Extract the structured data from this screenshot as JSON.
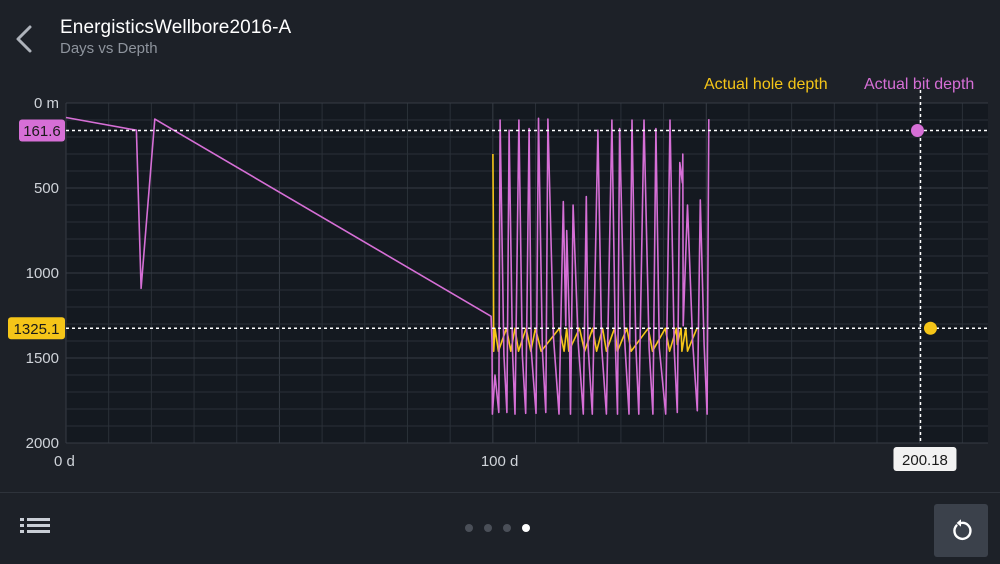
{
  "header": {
    "title": "EnergisticsWellbore2016-A",
    "subtitle": "Days vs Depth",
    "back_icon": "chevron-left-icon"
  },
  "legend": {
    "hole": {
      "label": "Actual hole depth",
      "color": "#f5c518"
    },
    "bit": {
      "label": "Actual bit depth",
      "color": "#d66fd6"
    }
  },
  "chart_data": {
    "type": "line",
    "xlim": [
      0,
      216
    ],
    "ylim": [
      0,
      2000
    ],
    "y_inverted": true,
    "grid": true,
    "x_ticks": [
      {
        "value": 0,
        "label": "0 d"
      },
      {
        "value": 100,
        "label": "100 d"
      }
    ],
    "y_ticks": [
      {
        "value": 0,
        "label": "0 m"
      },
      {
        "value": 500,
        "label": "500"
      },
      {
        "value": 1000,
        "label": "1000"
      },
      {
        "value": 1500,
        "label": "1500"
      },
      {
        "value": 2000,
        "label": "2000"
      }
    ],
    "cursor": {
      "x": 200.18,
      "x_label": "200.18",
      "bit_depth": 161.6,
      "bit_label": "161.6",
      "hole_depth": 1325.1,
      "hole_label": "1325.1"
    },
    "series": [
      {
        "name": "Actual bit depth",
        "color": "#d66fd6",
        "x": [
          0,
          16.5,
          17.6,
          20.8,
          99.6,
          99.8,
          99.9,
          100.5,
          101.4,
          101.7,
          102.6,
          103.3,
          103.8,
          104.6,
          105.2,
          106.1,
          106.9,
          107.7,
          108.5,
          109.0,
          110.1,
          110.7,
          111.6,
          112.4,
          112.9,
          114.2,
          115.5,
          116.5,
          117.1,
          117.3,
          117.9,
          118.2,
          118.8,
          120.0,
          121.2,
          121.9,
          122.3,
          123.3,
          124.6,
          125.5,
          126.6,
          127.9,
          128.7,
          129.2,
          129.7,
          130.9,
          131.9,
          132.6,
          133.5,
          134.2,
          135.4,
          136.6,
          137.5,
          138.2,
          139.0,
          140.5,
          141.5,
          142.5,
          143.2,
          143.8,
          144.4,
          144.5,
          144.6,
          145.6,
          146.8,
          147.9,
          148.6,
          149.5,
          150.2,
          150.6
        ],
        "y": [
          85,
          160,
          1090,
          95,
          1255,
          1400,
          1830,
          1600,
          1820,
          100,
          1480,
          1820,
          160,
          1460,
          1830,
          100,
          1480,
          1825,
          150,
          1460,
          1825,
          90,
          1460,
          1820,
          95,
          1380,
          1830,
          580,
          1310,
          750,
          1300,
          1830,
          600,
          1410,
          1830,
          550,
          1420,
          1830,
          160,
          1440,
          1830,
          100,
          1430,
          1830,
          150,
          1400,
          1830,
          100,
          1420,
          1830,
          100,
          1440,
          1830,
          150,
          1440,
          1830,
          100,
          1460,
          1820,
          350,
          470,
          300,
          1310,
          600,
          1400,
          1810,
          570,
          1420,
          1830,
          95
        ]
      },
      {
        "name": "Actual hole depth",
        "color": "#f5c518",
        "x": [
          100.0,
          100.1,
          100.2,
          100.5,
          101.3,
          103.2,
          104.2,
          105.2,
          106.0,
          107.8,
          108.9,
          110.0,
          111.3,
          115.6,
          116.7,
          117.3,
          117.8,
          120.3,
          121.5,
          123.4,
          124.3,
          125.7,
          126.6,
          128.5,
          129.2,
          131.4,
          132.4,
          136.4,
          137.4,
          140.4,
          141.4,
          143.0,
          143.2,
          144.1,
          144.3,
          145.2,
          145.6,
          147.8
        ],
        "y": [
          300,
          660,
          1460,
          1325,
          1460,
          1325,
          1460,
          1325,
          1460,
          1325,
          1460,
          1325,
          1460,
          1325,
          1460,
          1325,
          1460,
          1325,
          1460,
          1325,
          1460,
          1325,
          1460,
          1325,
          1460,
          1325,
          1460,
          1325,
          1460,
          1325,
          1460,
          1325,
          1420,
          1325,
          1460,
          1325,
          1460,
          1325
        ]
      }
    ]
  },
  "footer": {
    "menu_icon": "list-icon",
    "reset_icon": "reset-icon",
    "pages": 4,
    "active_page": 3
  }
}
